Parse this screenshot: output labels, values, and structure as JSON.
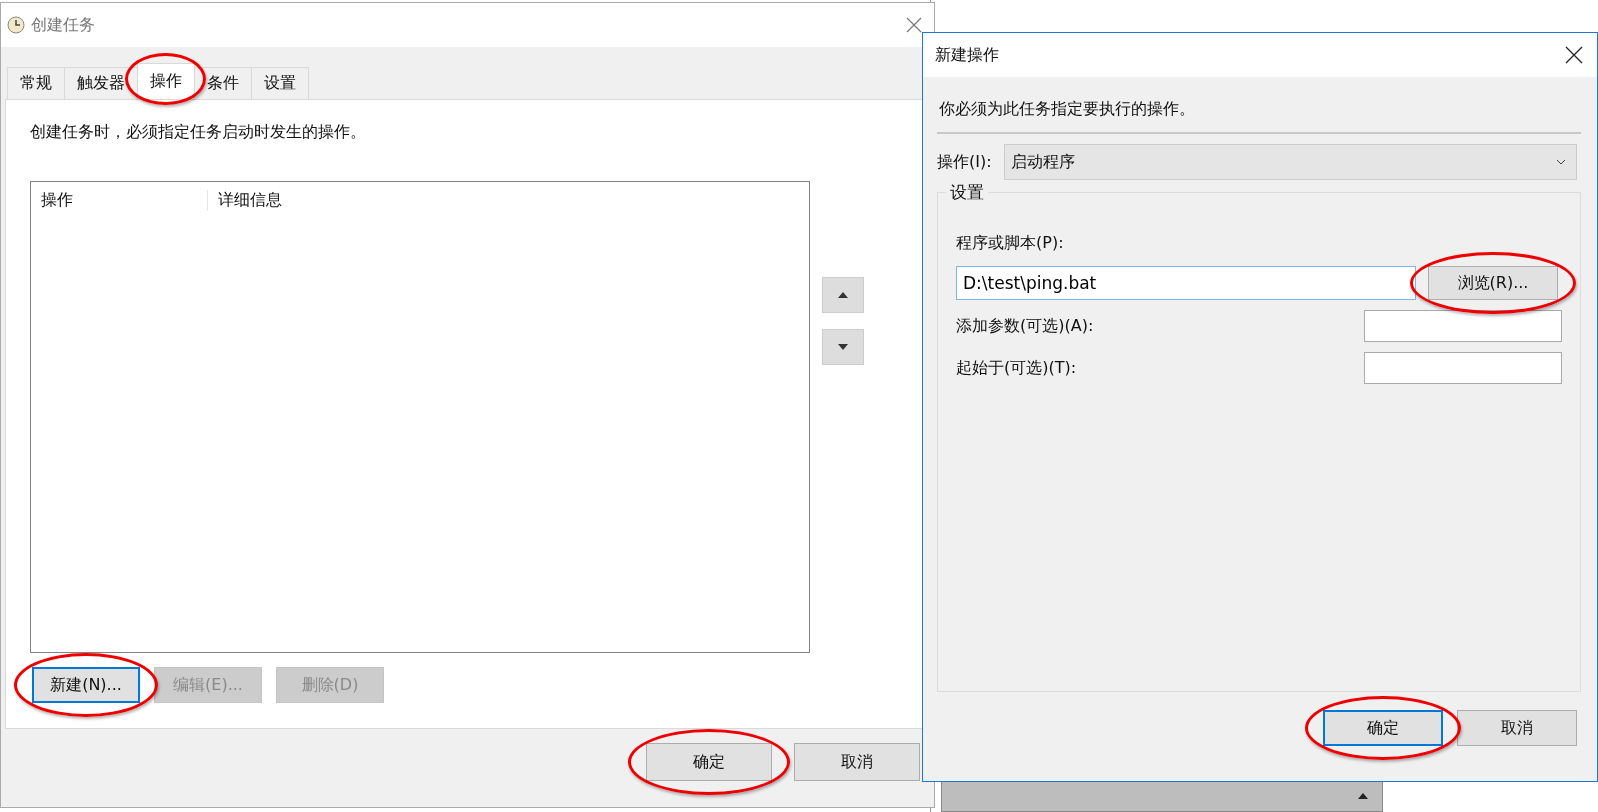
{
  "main_window": {
    "title": "创建任务",
    "tabs": [
      {
        "label": "常规",
        "selected": false,
        "highlighted": false
      },
      {
        "label": "触发器",
        "selected": false,
        "highlighted": false
      },
      {
        "label": "操作",
        "selected": true,
        "highlighted": true
      },
      {
        "label": "条件",
        "selected": false,
        "highlighted": false
      },
      {
        "label": "设置",
        "selected": false,
        "highlighted": false
      }
    ],
    "description": "创建任务时，必须指定任务启动时发生的操作。",
    "table": {
      "columns": [
        "操作",
        "详细信息"
      ]
    },
    "list_buttons": [
      {
        "label": "新建(N)...",
        "disabled": false,
        "focused": true,
        "highlighted": true
      },
      {
        "label": "编辑(E)...",
        "disabled": true,
        "focused": false,
        "highlighted": false
      },
      {
        "label": "删除(D)",
        "disabled": true,
        "focused": false,
        "highlighted": false
      }
    ],
    "footer_buttons": [
      {
        "label": "确定",
        "disabled": false,
        "focused": false,
        "highlighted": true
      },
      {
        "label": "取消",
        "disabled": false,
        "focused": false,
        "highlighted": false
      }
    ]
  },
  "dialog": {
    "title": "新建操作",
    "instruction": "你必须为此任务指定要执行的操作。",
    "action": {
      "label": "操作(I):",
      "value": "启动程序"
    },
    "group_title": "设置",
    "program": {
      "label": "程序或脚本(P):",
      "value": "D:\\test\\ping.bat"
    },
    "browse_button": {
      "label": "浏览(R)...",
      "highlighted": true
    },
    "fields": [
      {
        "label": "添加参数(可选)(A):"
      },
      {
        "label": "起始于(可选)(T):"
      }
    ],
    "footer_buttons": [
      {
        "label": "确定",
        "disabled": false,
        "focused": true,
        "highlighted": true
      },
      {
        "label": "取消",
        "disabled": false,
        "focused": false,
        "highlighted": false
      }
    ]
  }
}
